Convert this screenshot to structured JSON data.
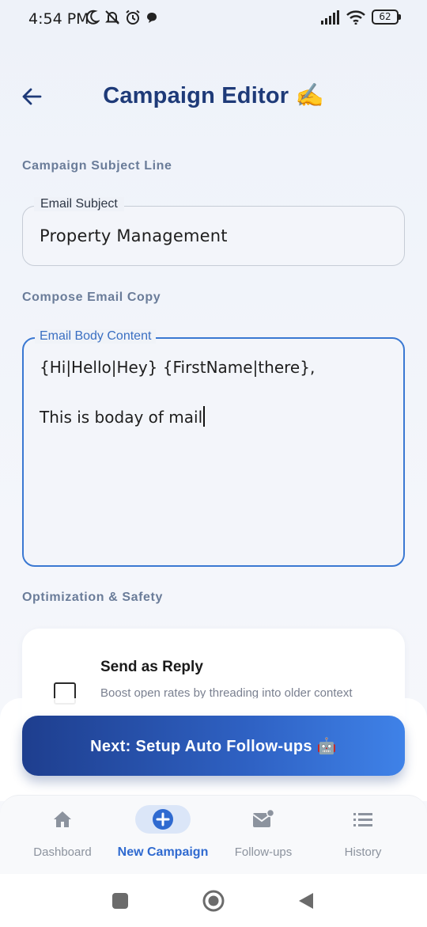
{
  "status_bar": {
    "time": "4:54 PM",
    "battery": "62"
  },
  "header": {
    "title": "Campaign Editor ✍️"
  },
  "subject_section": {
    "label": "Campaign Subject Line",
    "field_label": "Email Subject",
    "value": "Property Management"
  },
  "body_section": {
    "label": "Compose Email Copy",
    "field_label": "Email Body Content",
    "lines": [
      "{Hi|Hello|Hey} {FirstName|there},",
      "This is boday of mail"
    ]
  },
  "optimization_section": {
    "label": "Optimization & Safety",
    "option": {
      "title": "Send as Reply",
      "description": "Boost open rates by threading into older context",
      "checked": false
    }
  },
  "cta": {
    "label": "Next: Setup Auto Follow-ups 🤖"
  },
  "bottom_nav": {
    "items": [
      {
        "label": "Dashboard",
        "icon": "home-icon",
        "active": false
      },
      {
        "label": "New Campaign",
        "icon": "add-circle-icon",
        "active": true
      },
      {
        "label": "Follow-ups",
        "icon": "mail-notification-icon",
        "active": false
      },
      {
        "label": "History",
        "icon": "list-icon",
        "active": false
      }
    ]
  },
  "colors": {
    "primary": "#1e3a78",
    "accent": "#3a78d2",
    "muted_label": "#6a7c99"
  }
}
